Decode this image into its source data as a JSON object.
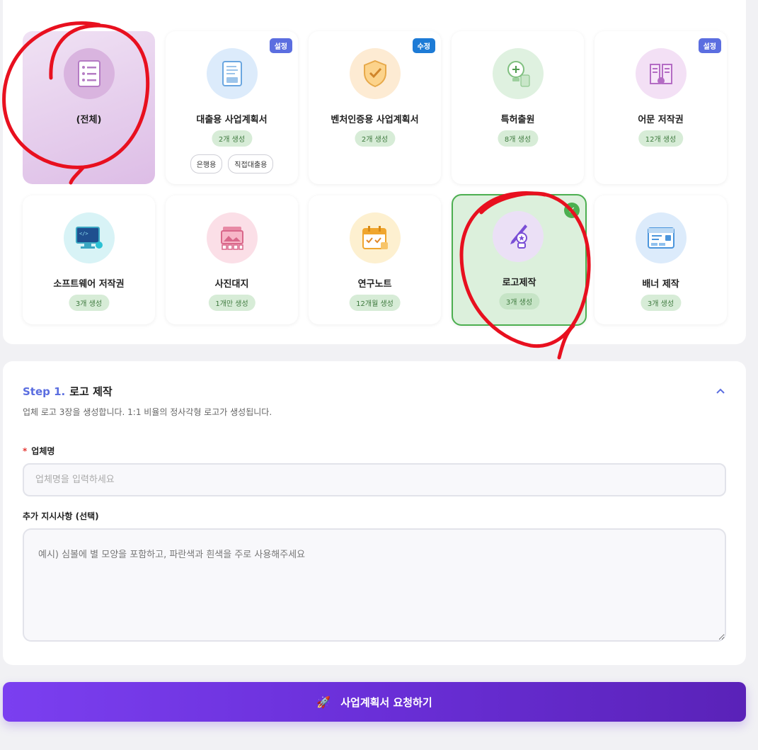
{
  "cards": [
    {
      "title": "(전체)",
      "icon": "checklist-icon",
      "gen": "",
      "badge": "",
      "tags": []
    },
    {
      "title": "대출용 사업계획서",
      "icon": "document-icon",
      "gen": "2개 생성",
      "badge": "설정",
      "tags": [
        "은행용",
        "직접대출용"
      ]
    },
    {
      "title": "벤처인증용 사업계획서",
      "icon": "shield-check-icon",
      "gen": "2개 생성",
      "badge": "수정",
      "tags": []
    },
    {
      "title": "특허출원",
      "icon": "lightbulb-icon",
      "gen": "8개 생성",
      "badge": "",
      "tags": []
    },
    {
      "title": "어문 저작권",
      "icon": "book-icon",
      "gen": "12개 생성",
      "badge": "설정",
      "tags": []
    },
    {
      "title": "소프트웨어 저작권",
      "icon": "monitor-code-icon",
      "gen": "3개 생성",
      "badge": "",
      "tags": []
    },
    {
      "title": "사진대지",
      "icon": "photo-album-icon",
      "gen": "1개만 생성",
      "badge": "",
      "tags": []
    },
    {
      "title": "연구노트",
      "icon": "calendar-icon",
      "gen": "12개월 생성",
      "badge": "",
      "tags": []
    },
    {
      "title": "로고제작",
      "icon": "pen-badge-icon",
      "gen": "3개 생성",
      "badge": "",
      "tags": [],
      "selected": true
    },
    {
      "title": "배너 제작",
      "icon": "banner-icon",
      "gen": "3개 생성",
      "badge": "",
      "tags": []
    }
  ],
  "step": {
    "number": "Step 1.",
    "title": "로고 제작",
    "description": "업체 로고 3장을 생성합니다. 1:1 비율의 정사각형 로고가 생성됩니다.",
    "required_mark": "*",
    "company_label": "업체명",
    "company_placeholder": "업체명을 입력하세요",
    "company_value": "",
    "extra_label": "추가 지시사항 (선택)",
    "extra_placeholder": "예시) 심볼에 별 모양을 포함하고, 파란색과 흰색을 주로 사용해주세요",
    "extra_value": ""
  },
  "submit": {
    "icon": "rocket-icon",
    "emoji": "🚀",
    "label": "사업계획서 요청하기"
  },
  "colors": {
    "accent": "#5b6ee0",
    "selected_border": "#4caf50",
    "annotation": "#e8101f",
    "button_start": "#7b3ff0",
    "button_end": "#5a22b8"
  }
}
